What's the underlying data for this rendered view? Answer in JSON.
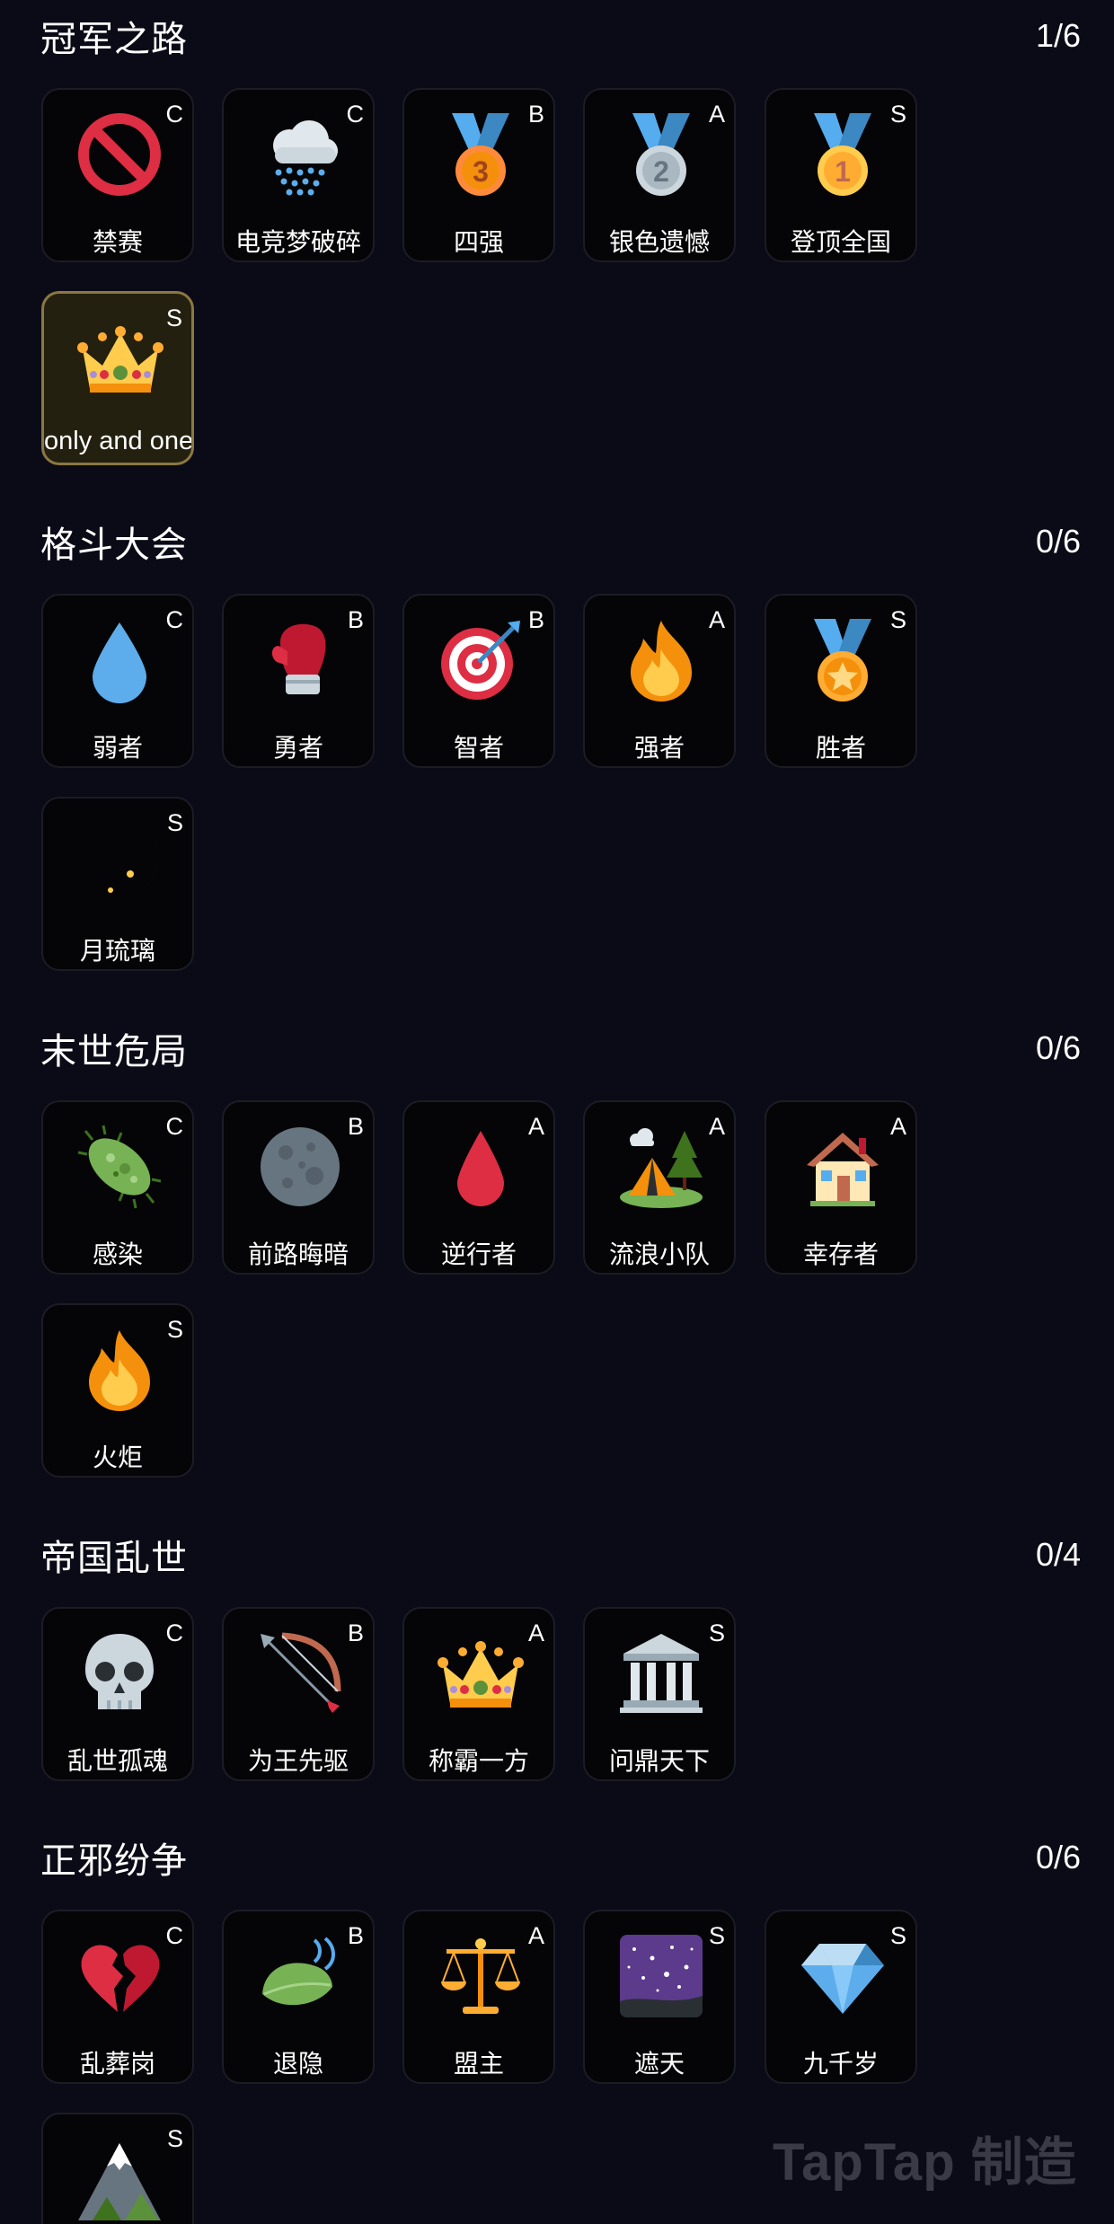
{
  "sections": [
    {
      "title": "冠军之路",
      "progress": "1/6",
      "items": [
        {
          "label": "禁赛",
          "grade": "C",
          "icon": "prohibited-icon"
        },
        {
          "label": "电竞梦破碎",
          "grade": "C",
          "icon": "rain-cloud-icon"
        },
        {
          "label": "四强",
          "grade": "B",
          "icon": "bronze-medal-icon"
        },
        {
          "label": "银色遗憾",
          "grade": "A",
          "icon": "silver-medal-icon"
        },
        {
          "label": "登顶全国",
          "grade": "S",
          "icon": "gold-medal-icon"
        },
        {
          "label": "only and one",
          "grade": "S",
          "icon": "crown-icon",
          "selected": true
        }
      ]
    },
    {
      "title": "格斗大会",
      "progress": "0/6",
      "items": [
        {
          "label": "弱者",
          "grade": "C",
          "icon": "droplet-icon"
        },
        {
          "label": "勇者",
          "grade": "B",
          "icon": "boxing-glove-icon"
        },
        {
          "label": "智者",
          "grade": "B",
          "icon": "target-icon"
        },
        {
          "label": "强者",
          "grade": "A",
          "icon": "fire-icon"
        },
        {
          "label": "胜者",
          "grade": "S",
          "icon": "star-medal-icon"
        },
        {
          "label": "月琉璃",
          "grade": "S",
          "icon": "crescent-moon-icon"
        }
      ]
    },
    {
      "title": "末世危局",
      "progress": "0/6",
      "items": [
        {
          "label": "感染",
          "grade": "C",
          "icon": "microbe-icon"
        },
        {
          "label": "前路晦暗",
          "grade": "B",
          "icon": "full-moon-icon"
        },
        {
          "label": "逆行者",
          "grade": "A",
          "icon": "blood-drop-icon"
        },
        {
          "label": "流浪小队",
          "grade": "A",
          "icon": "camping-icon"
        },
        {
          "label": "幸存者",
          "grade": "A",
          "icon": "house-icon"
        },
        {
          "label": "火炬",
          "grade": "S",
          "icon": "fire-icon"
        }
      ]
    },
    {
      "title": "帝国乱世",
      "progress": "0/4",
      "items": [
        {
          "label": "乱世孤魂",
          "grade": "C",
          "icon": "skull-icon"
        },
        {
          "label": "为王先驱",
          "grade": "B",
          "icon": "bow-and-arrow-icon"
        },
        {
          "label": "称霸一方",
          "grade": "A",
          "icon": "crown-icon"
        },
        {
          "label": "问鼎天下",
          "grade": "S",
          "icon": "classical-building-icon"
        }
      ]
    },
    {
      "title": "正邪纷争",
      "progress": "0/6",
      "items": [
        {
          "label": "乱葬岗",
          "grade": "C",
          "icon": "broken-heart-icon"
        },
        {
          "label": "退隐",
          "grade": "B",
          "icon": "leaf-wind-icon"
        },
        {
          "label": "盟主",
          "grade": "A",
          "icon": "balance-scale-icon"
        },
        {
          "label": "遮天",
          "grade": "S",
          "icon": "milky-way-icon"
        },
        {
          "label": "九千岁",
          "grade": "S",
          "icon": "gem-icon"
        },
        {
          "label": "",
          "grade": "S",
          "icon": "mountain-icon"
        }
      ]
    }
  ],
  "watermark": "TapTap 制造",
  "colors": {
    "background": "#0b0b17",
    "card": "#050507",
    "card_border": "#1c1c26",
    "selected_border": "#8a7743"
  }
}
